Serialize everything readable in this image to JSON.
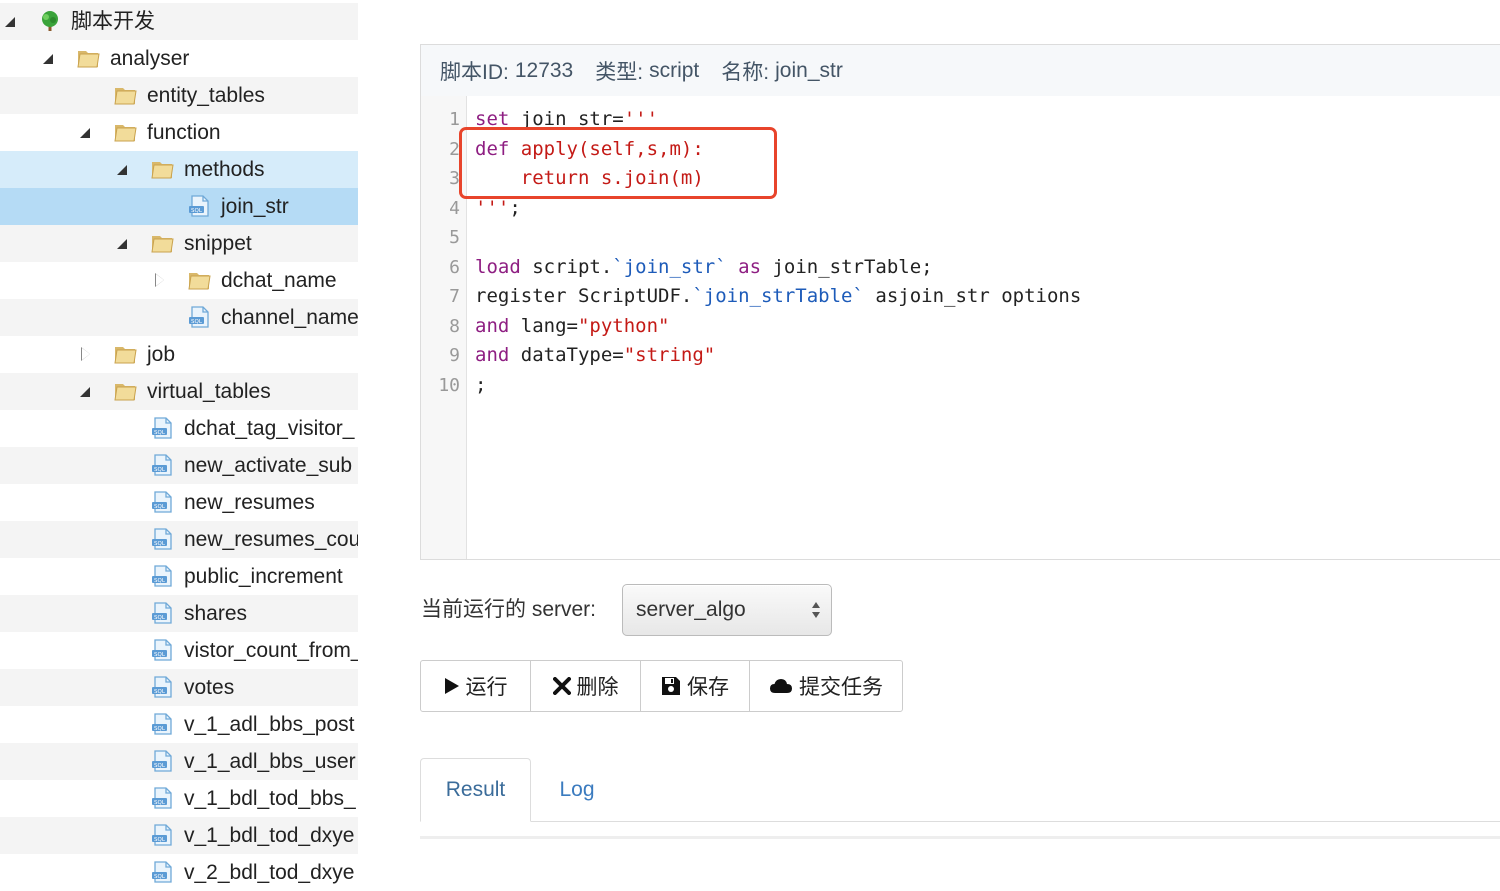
{
  "tree": {
    "nodes": [
      {
        "label": "脚本开发",
        "type": "root",
        "toggle": "open"
      },
      {
        "label": "analyser",
        "type": "folder",
        "toggle": "open"
      },
      {
        "label": "entity_tables",
        "type": "folder",
        "toggle": "none"
      },
      {
        "label": "function",
        "type": "folder",
        "toggle": "open"
      },
      {
        "label": "methods",
        "type": "folder",
        "toggle": "open"
      },
      {
        "label": "join_str",
        "type": "file",
        "toggle": "none"
      },
      {
        "label": "snippet",
        "type": "folder",
        "toggle": "open"
      },
      {
        "label": "dchat_name",
        "type": "folder",
        "toggle": "closed"
      },
      {
        "label": "channel_name",
        "type": "file",
        "toggle": "none"
      },
      {
        "label": "job",
        "type": "folder",
        "toggle": "closed"
      },
      {
        "label": "virtual_tables",
        "type": "folder",
        "toggle": "open"
      },
      {
        "label": "dchat_tag_visitor_",
        "type": "file",
        "toggle": "none"
      },
      {
        "label": "new_activate_sub",
        "type": "file",
        "toggle": "none"
      },
      {
        "label": "new_resumes",
        "type": "file",
        "toggle": "none"
      },
      {
        "label": "new_resumes_cou",
        "type": "file",
        "toggle": "none"
      },
      {
        "label": "public_increment",
        "type": "file",
        "toggle": "none"
      },
      {
        "label": "shares",
        "type": "file",
        "toggle": "none"
      },
      {
        "label": "vistor_count_from_",
        "type": "file",
        "toggle": "none"
      },
      {
        "label": "votes",
        "type": "file",
        "toggle": "none"
      },
      {
        "label": "v_1_adl_bbs_post",
        "type": "file",
        "toggle": "none"
      },
      {
        "label": "v_1_adl_bbs_user",
        "type": "file",
        "toggle": "none"
      },
      {
        "label": "v_1_bdl_tod_bbs_",
        "type": "file",
        "toggle": "none"
      },
      {
        "label": "v_1_bdl_tod_dxye",
        "type": "file",
        "toggle": "none"
      },
      {
        "label": "v_2_bdl_tod_dxye",
        "type": "file",
        "toggle": "none"
      }
    ]
  },
  "info": {
    "id_label": "脚本ID:",
    "id_value": "12733",
    "type_label": "类型:",
    "type_value": "script",
    "name_label": "名称:",
    "name_value": "join_str"
  },
  "editor": {
    "line_numbers": [
      "1",
      "2",
      "3",
      "4",
      "5",
      "6",
      "7",
      "8",
      "9",
      "10"
    ],
    "lines": [
      [
        {
          "t": "set",
          "c": "kw"
        },
        {
          "t": " join_str=",
          "c": ""
        },
        {
          "t": "'''",
          "c": "str"
        }
      ],
      [
        {
          "t": "def ",
          "c": "kw"
        },
        {
          "t": "apply(self,s,m):",
          "c": "str"
        }
      ],
      [
        {
          "t": "    return s.join(m)",
          "c": "str"
        }
      ],
      [
        {
          "t": "'''",
          "c": "str"
        },
        {
          "t": ";",
          "c": ""
        }
      ],
      [],
      [
        {
          "t": "load",
          "c": "kw"
        },
        {
          "t": " script.",
          "c": ""
        },
        {
          "t": "`join_str`",
          "c": "tk"
        },
        {
          "t": " ",
          "c": ""
        },
        {
          "t": "as",
          "c": "kw"
        },
        {
          "t": " join_strTable;",
          "c": ""
        }
      ],
      [
        {
          "t": "register ScriptUDF.",
          "c": ""
        },
        {
          "t": "`join_strTable`",
          "c": "tk"
        },
        {
          "t": " asjoin_str options",
          "c": ""
        }
      ],
      [
        {
          "t": "and",
          "c": "kw"
        },
        {
          "t": " lang=",
          "c": ""
        },
        {
          "t": "\"python\"",
          "c": "str"
        }
      ],
      [
        {
          "t": "and",
          "c": "kw"
        },
        {
          "t": " dataType=",
          "c": ""
        },
        {
          "t": "\"string\"",
          "c": "str"
        }
      ],
      [
        {
          "t": ";",
          "c": ""
        }
      ]
    ]
  },
  "server": {
    "label": "当前运行的 server:",
    "selected": "server_algo"
  },
  "buttons": {
    "run": "运行",
    "delete": "删除",
    "save": "保存",
    "submit": "提交任务"
  },
  "tabs": {
    "result": "Result",
    "log": "Log"
  }
}
